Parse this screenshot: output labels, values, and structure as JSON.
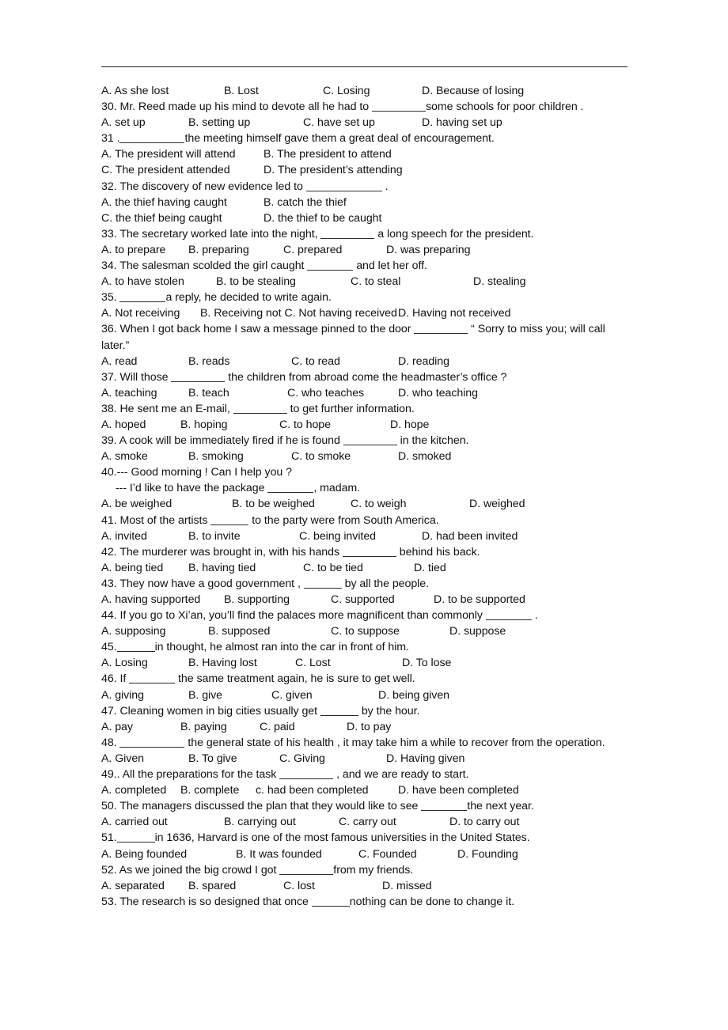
{
  "document": {
    "type": "grammar-worksheet",
    "has_top_rule": true,
    "text_color": "#111111",
    "rule_color": "#1c1c1c",
    "background": "#ffffff"
  },
  "questions": [
    {
      "id": "q29-options",
      "kind": "options",
      "options": [
        "A. As she lost",
        "B. Lost",
        "C. Losing",
        "D. Because of losing"
      ]
    },
    {
      "id": "q30",
      "kind": "stem",
      "number": "30.",
      "before": " Mr. Reed made up his mind to devote all he had to ",
      "after": "some schools for poor children .",
      "blank": "b-l"
    },
    {
      "id": "q30-options",
      "kind": "options",
      "options": [
        "A. set up",
        "B. setting up",
        "C. have set up",
        "D. having set up"
      ]
    },
    {
      "id": "q31",
      "kind": "stem",
      "number": "31 .",
      "before": "",
      "after": "the meeting himself gave them a great deal of encouragement.",
      "blank": "b-xl"
    },
    {
      "id": "q31-options-1",
      "kind": "options",
      "options": [
        "A. The president will attend",
        "B. The president to attend"
      ]
    },
    {
      "id": "q31-options-2",
      "kind": "options",
      "options": [
        "C. The president attended",
        "D. The president’s attending"
      ]
    },
    {
      "id": "q32",
      "kind": "stem",
      "number": "32.",
      "before": " The discovery of new evidence led to  ",
      "after": " .",
      "blank": "b-xxl"
    },
    {
      "id": "q32-options-1",
      "kind": "options",
      "options": [
        "A. the thief having caught",
        "B. catch the thief"
      ]
    },
    {
      "id": "q32-options-2",
      "kind": "options",
      "options": [
        "C. the thief being caught",
        "D. the thief to be caught"
      ]
    },
    {
      "id": "q33",
      "kind": "stem",
      "number": "33.",
      "before": " The secretary worked late into the night,  ",
      "after": " a long speech for the president.",
      "blank": "b-l"
    },
    {
      "id": "q33-options",
      "kind": "options",
      "options": [
        "A. to prepare",
        "B. preparing",
        "C. prepared",
        "D. was preparing"
      ]
    },
    {
      "id": "q34",
      "kind": "stem",
      "number": "34.",
      "before": " The salesman scolded the girl caught  ",
      "after": " and let her off.",
      "blank": "b-m"
    },
    {
      "id": "q34-options",
      "kind": "options",
      "options": [
        "A. to have stolen",
        "B. to be stealing",
        "C. to steal",
        "D. stealing"
      ]
    },
    {
      "id": "q35",
      "kind": "stem",
      "number": "35.",
      "before": "  ",
      "after": "a reply, he decided to write again.",
      "blank": "b-m"
    },
    {
      "id": "q35-options",
      "kind": "options",
      "options": [
        "A. Not receiving",
        "B. Receiving not C. Not having received",
        "D. Having not received"
      ]
    },
    {
      "id": "q36",
      "kind": "wrap",
      "number": "36.",
      "before": " When I got back home I saw a message pinned to the door  ",
      "after": " “ Sorry to miss you; will call later.”",
      "blank": "b-l"
    },
    {
      "id": "q36-options",
      "kind": "options",
      "options": [
        "A. read",
        "B. reads",
        "C. to read",
        "D. reading"
      ]
    },
    {
      "id": "q37",
      "kind": "stem",
      "number": "37.",
      "before": " Will those  ",
      "after": " the children from abroad come the headmaster’s office ?",
      "blank": "b-l"
    },
    {
      "id": "q37-options",
      "kind": "options",
      "options": [
        "A. teaching",
        "B. teach",
        "C. who teaches",
        "D. who teaching"
      ]
    },
    {
      "id": "q38",
      "kind": "stem",
      "number": "38.",
      "before": " He sent me an E-mail,  ",
      "after": " to get further information.",
      "blank": "b-l"
    },
    {
      "id": "q38-options",
      "kind": "options",
      "options": [
        "A. hoped",
        "B. hoping",
        "C. to hope",
        "D. hope"
      ]
    },
    {
      "id": "q39",
      "kind": "stem",
      "number": "39.",
      "before": " A cook will be immediately fired if he is found  ",
      "after": " in the kitchen.",
      "blank": "b-l"
    },
    {
      "id": "q39-options",
      "kind": "options",
      "options": [
        "A. smoke",
        "B. smoking",
        "C. to smoke",
        "D. smoked"
      ]
    },
    {
      "id": "q40a",
      "kind": "plain",
      "text": "40.--- Good morning ! Can I help you ?"
    },
    {
      "id": "q40b",
      "kind": "stem-indent",
      "number": "--- I’d like to have the package ",
      "before": "",
      "after": ", madam.",
      "blank": "b-m"
    },
    {
      "id": "q40-options",
      "kind": "options",
      "options": [
        "A. be weighed",
        "B. to be weighed",
        "C. to weigh",
        "D. weighed"
      ]
    },
    {
      "id": "q41",
      "kind": "stem",
      "number": "41.",
      "before": " Most of the artists  ",
      "after": " to the party were from South America.",
      "blank": "b-s"
    },
    {
      "id": "q41-options",
      "kind": "options",
      "options": [
        "A. invited",
        "B. to invite",
        "C. being invited",
        "D. had been invited"
      ]
    },
    {
      "id": "q42",
      "kind": "stem",
      "number": "42.",
      "before": " The murderer was brought in, with his hands  ",
      "after": " behind his back.",
      "blank": "b-l"
    },
    {
      "id": "q42-options",
      "kind": "options",
      "options": [
        "A. being tied",
        "B. having tied",
        "C. to be tied",
        "D. tied"
      ]
    },
    {
      "id": "q43",
      "kind": "stem",
      "number": "43.",
      "before": " They now have a good government ,  ",
      "after": " by all the people.",
      "blank": "b-s"
    },
    {
      "id": "q43-options",
      "kind": "options",
      "options": [
        "A. having supported",
        "B. supporting",
        "C. supported",
        "D. to be supported"
      ]
    },
    {
      "id": "q44",
      "kind": "stem",
      "number": "44.",
      "before": " If you go to Xi’an, you’ll find the palaces more magnificent than commonly  ",
      "after": " .",
      "blank": "b-m"
    },
    {
      "id": "q44-options",
      "kind": "options",
      "options": [
        "A. supposing",
        "B. supposed",
        "C. to suppose",
        "D. suppose"
      ]
    },
    {
      "id": "q45",
      "kind": "stem",
      "number": "45.",
      "before": "",
      "after": "in thought, he almost ran into the car in front of him.",
      "blank": "b-s"
    },
    {
      "id": "q45-options",
      "kind": "options",
      "options": [
        "A. Losing",
        "B. Having lost",
        "C. Lost",
        "D. To lose"
      ]
    },
    {
      "id": "q46",
      "kind": "stem",
      "number": "46.",
      "before": " If  ",
      "after": " the same treatment again, he is sure to get well.",
      "blank": "b-m"
    },
    {
      "id": "q46-options",
      "kind": "options",
      "options": [
        "A. giving",
        "B. give",
        "C. given",
        "D. being given"
      ]
    },
    {
      "id": "q47",
      "kind": "stem",
      "number": "47.",
      "before": " Cleaning women in big cities usually get  ",
      "after": " by the hour.",
      "blank": "b-s"
    },
    {
      "id": "q47-options",
      "kind": "options",
      "options": [
        "A. pay",
        "B. paying",
        "C. paid",
        "D. to pay"
      ]
    },
    {
      "id": "q48",
      "kind": "justify",
      "number": "48.",
      "before": "  ",
      "after": " the general state of his health , it may take him a while to recover from the operation.",
      "blank": "b-xl"
    },
    {
      "id": "q48-options",
      "kind": "options",
      "options": [
        "A. Given",
        "B. To give",
        "C. Giving",
        "D. Having given"
      ]
    },
    {
      "id": "q49",
      "kind": "stem",
      "number": "49..",
      "before": " All the preparations for the task  ",
      "after": " , and we are ready to start.",
      "blank": "b-l"
    },
    {
      "id": "q49-options",
      "kind": "options",
      "options": [
        "A. completed",
        "B. complete",
        "c. had been completed",
        "D. have been completed"
      ]
    },
    {
      "id": "q50",
      "kind": "stem",
      "number": "50.",
      "before": " The managers discussed the plan that they would like to see  ",
      "after": "the next year.",
      "blank": "b-m"
    },
    {
      "id": "q50-options",
      "kind": "options",
      "options": [
        "A. carried out",
        "B. carrying out",
        "C. carry out",
        "D. to carry out"
      ]
    },
    {
      "id": "q51",
      "kind": "stem",
      "number": "51.",
      "before": "",
      "after": "in 1636, Harvard is one of the most famous universities in the United States.",
      "blank": "b-s"
    },
    {
      "id": "q51-options",
      "kind": "options",
      "options": [
        "A. Being founded",
        "B. It was founded",
        "C. Founded",
        "D. Founding"
      ]
    },
    {
      "id": "q52",
      "kind": "stem",
      "number": "52.",
      "before": " As we joined the big crowd I got  ",
      "after": "from my friends.",
      "blank": "b-l"
    },
    {
      "id": "q52-options",
      "kind": "options",
      "options": [
        "A. separated",
        "B. spared",
        "C. lost",
        "D. missed"
      ]
    },
    {
      "id": "q53",
      "kind": "stem",
      "number": "53.",
      "before": " The research is so designed that once  ",
      "after": "nothing can be done to change it.",
      "blank": "b-s"
    }
  ],
  "option_columns": {
    "q29-options": [
      0,
      155,
      280,
      405
    ],
    "q30-options": [
      0,
      110,
      255,
      405
    ],
    "q31-options-1": [
      0,
      205
    ],
    "q31-options-2": [
      0,
      205
    ],
    "q32-options-1": [
      0,
      205
    ],
    "q32-options-2": [
      0,
      205
    ],
    "q33-options": [
      0,
      110,
      230,
      360
    ],
    "q34-options": [
      0,
      145,
      315,
      470
    ],
    "q35-options": [
      0,
      125,
      375
    ],
    "q36-options": [
      0,
      110,
      240,
      375
    ],
    "q37-options": [
      0,
      110,
      235,
      375
    ],
    "q38-options": [
      0,
      100,
      225,
      365
    ],
    "q39-options": [
      0,
      110,
      240,
      375
    ],
    "q40-options": [
      0,
      165,
      315,
      465
    ],
    "q41-options": [
      0,
      110,
      250,
      405
    ],
    "q42-options": [
      0,
      110,
      255,
      395
    ],
    "q43-options": [
      0,
      155,
      290,
      420
    ],
    "q44-options": [
      0,
      135,
      290,
      440
    ],
    "q45-options": [
      0,
      110,
      245,
      380
    ],
    "q46-options": [
      0,
      110,
      215,
      350
    ],
    "q47-options": [
      0,
      100,
      200,
      310
    ],
    "q48-options": [
      0,
      110,
      225,
      360
    ],
    "q49-options": [
      0,
      100,
      195,
      375
    ],
    "q50-options": [
      0,
      155,
      300,
      440
    ],
    "q51-options": [
      0,
      170,
      325,
      450
    ],
    "q52-options": [
      0,
      110,
      230,
      355
    ]
  }
}
